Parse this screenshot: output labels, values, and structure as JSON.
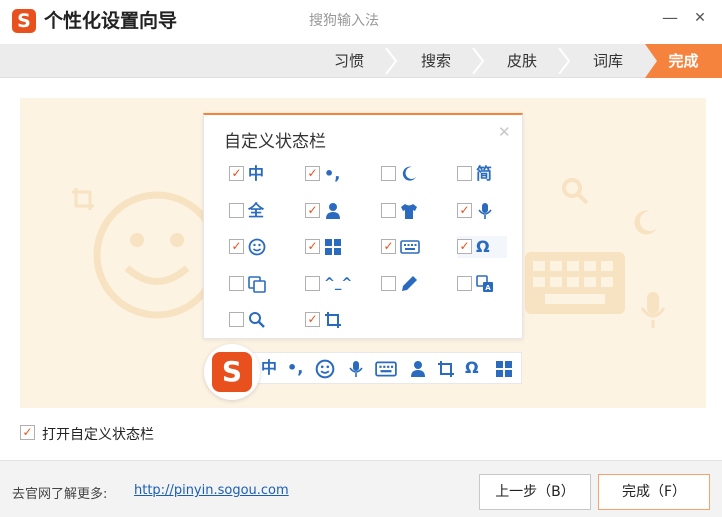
{
  "window": {
    "logo_text": "S",
    "title": "个性化设置向导",
    "subtitle": "搜狗输入法",
    "minimize": "—",
    "close": "✕"
  },
  "steps": [
    {
      "label": "习惯",
      "active": false
    },
    {
      "label": "搜索",
      "active": false
    },
    {
      "label": "皮肤",
      "active": false
    },
    {
      "label": "词库",
      "active": false
    },
    {
      "label": "完成",
      "active": true
    }
  ],
  "panel": {
    "title": "自定义状态栏",
    "close": "✕",
    "options": [
      {
        "icon": "zhong-char",
        "glyph": "中",
        "checked": true
      },
      {
        "icon": "punctuation-icon",
        "glyph": "•,",
        "checked": true
      },
      {
        "icon": "moon-icon",
        "glyph": "",
        "checked": false
      },
      {
        "icon": "jian-char",
        "glyph": "简",
        "checked": false
      },
      {
        "icon": "quan-char",
        "glyph": "全",
        "checked": false
      },
      {
        "icon": "user-icon",
        "glyph": "",
        "checked": true
      },
      {
        "icon": "shirt-icon",
        "glyph": "",
        "checked": false
      },
      {
        "icon": "microphone-icon",
        "glyph": "",
        "checked": true
      },
      {
        "icon": "smiley-icon",
        "glyph": "",
        "checked": true
      },
      {
        "icon": "grid-icon",
        "glyph": "",
        "checked": true
      },
      {
        "icon": "keyboard-icon",
        "glyph": "",
        "checked": true
      },
      {
        "icon": "omega-icon",
        "glyph": "Ω",
        "checked": true
      },
      {
        "icon": "window-icon",
        "glyph": "",
        "checked": false
      },
      {
        "icon": "kaomoji-icon",
        "glyph": "^_^",
        "checked": false
      },
      {
        "icon": "pen-icon",
        "glyph": "",
        "checked": false
      },
      {
        "icon": "translate-icon",
        "glyph": "",
        "checked": false
      },
      {
        "icon": "search-icon",
        "glyph": "",
        "checked": false
      },
      {
        "icon": "crop-icon",
        "glyph": "",
        "checked": true
      }
    ]
  },
  "statusbar": {
    "logo_text": "S",
    "icons": [
      "zhong-char",
      "punctuation-icon",
      "smiley-icon",
      "microphone-icon",
      "keyboard-icon",
      "user-icon",
      "crop-icon",
      "omega-icon",
      "grid-icon"
    ],
    "zhong": "中",
    "punct": "•,",
    "omega": "Ω"
  },
  "enable_statusbar": {
    "label": "打开自定义状态栏",
    "checked": true
  },
  "footer": {
    "text": "去官网了解更多:",
    "link": "http://pinyin.sogou.com",
    "prev_button": "上一步（B）",
    "finish_button": "完成（F）"
  },
  "colors": {
    "accent": "#f5823d",
    "brand": "#e8501e",
    "icon_blue": "#2b6bbf",
    "banner_bg": "#fdf3e3"
  }
}
